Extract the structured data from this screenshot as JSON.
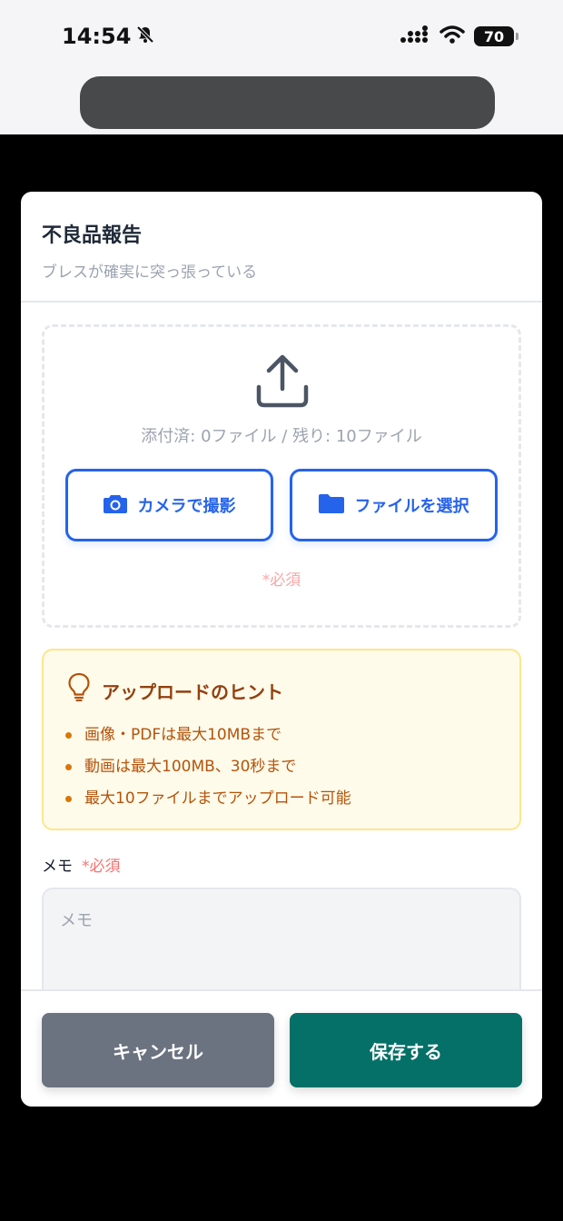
{
  "status": {
    "time": "14:54",
    "battery": "70"
  },
  "modal": {
    "title": "不良品報告",
    "subtitle": "ブレスが確実に突っ張っている"
  },
  "upload": {
    "attach_status": "添付済: 0ファイル / 残り: 10ファイル",
    "camera_label": "カメラで撮影",
    "file_label": "ファイルを選択",
    "required_note": "*必須"
  },
  "hints": {
    "title": "アップロードのヒント",
    "items": [
      "画像・PDFは最大10MBまで",
      "動画は最大100MB、30秒まで",
      "最大10ファイルまでアップロード可能"
    ]
  },
  "memo": {
    "label": "メモ",
    "required": "*必須",
    "placeholder": "メモ",
    "value": ""
  },
  "footer": {
    "cancel_label": "キャンセル",
    "save_label": "保存する"
  },
  "colors": {
    "primary_blue": "#2563eb",
    "save_green": "#047068",
    "cancel_gray": "#6b7280",
    "hint_bg": "#fffbeb",
    "hint_text": "#b45309",
    "required_red": "#f87171"
  },
  "icons": {
    "mute": "bell-slash-icon",
    "signal": "cellular-signal-icon",
    "wifi": "wifi-icon",
    "upload": "upload-icon",
    "camera": "camera-icon",
    "folder": "folder-icon",
    "hint": "lightbulb-icon"
  }
}
